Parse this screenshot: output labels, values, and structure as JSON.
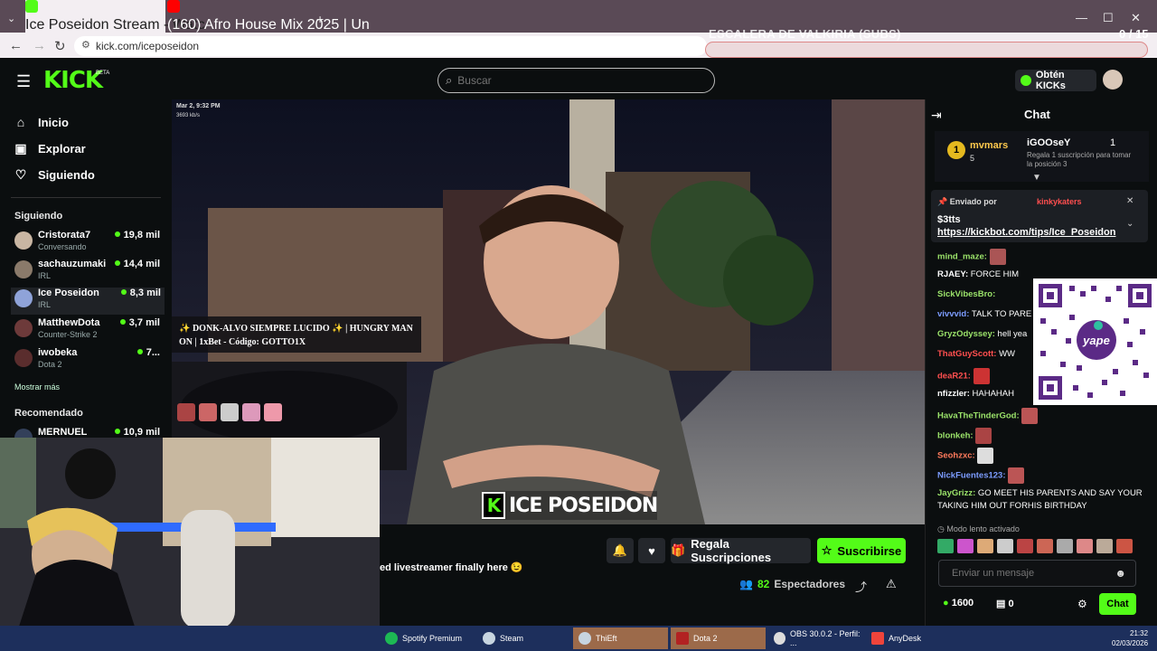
{
  "browser": {
    "tabs": [
      {
        "title": "Ice Poseidon Stream - Watc",
        "active": true
      },
      {
        "title": "(160) Afro House Mix 2025 | Un",
        "active": false
      }
    ],
    "new_tab": "+",
    "url": "kick.com/iceposeidon",
    "overlay_title": "ESCALERA DE VALKIRIA (SUBS)",
    "overlay_count": "0 / 15"
  },
  "header": {
    "logo": "KICK",
    "logo_beta": "BETA",
    "search_placeholder": "Buscar",
    "get_kicks": "Obtén KICKs"
  },
  "sidebar": {
    "nav": [
      {
        "label": "Inicio",
        "icon": "home-icon"
      },
      {
        "label": "Explorar",
        "icon": "compass-icon"
      },
      {
        "label": "Siguiendo",
        "icon": "heart-icon"
      }
    ],
    "following_heading": "Siguiendo",
    "following": [
      {
        "name": "Cristorata7",
        "category": "Conversando",
        "viewers": "19,8 mil"
      },
      {
        "name": "sachauzumaki",
        "category": "IRL",
        "viewers": "14,4 mil"
      },
      {
        "name": "Ice Poseidon",
        "category": "IRL",
        "viewers": "8,3 mil"
      },
      {
        "name": "MatthewDota",
        "category": "Counter-Strike 2",
        "viewers": "3,7 mil"
      },
      {
        "name": "iwobeka",
        "category": "Dota 2",
        "viewers": "7..."
      }
    ],
    "show_more": "Mostrar más",
    "recommended_heading": "Recomendado",
    "recommended": [
      {
        "name": "MERNUEL",
        "viewers": "10,9 mil"
      }
    ]
  },
  "video": {
    "overlay_date": "Mar 2, 9:32 PM",
    "overlay_bitrate": "3693 kb/s",
    "promo_text": "✨ DONK-ALVO SIEMPRE LUCIDO ✨ | HUNGRY MAN ON | 1xBet - Código: GOTTO1X",
    "streamer_tag": "ICE POSEIDON"
  },
  "stream_info": {
    "title": "ed livestreamer finally here 😉",
    "gift_subs": "Regala Suscripciones",
    "subscribe": "Suscribirse",
    "viewers": "82",
    "viewers_label": "Espectadores"
  },
  "chat": {
    "title": "Chat",
    "sub_banner": {
      "top_user": "mvmars",
      "top_user_count": "5",
      "gifter": "iGOOseY",
      "gifter_count": "1",
      "gifter_desc": "Regala 1 suscripción para tomar la posición 3"
    },
    "pinned": {
      "sent_by": "Enviado por",
      "user": "kinkykaters",
      "amount": "$3tts",
      "link": "https://kickbot.com/tips/Ice_Poseidon"
    },
    "messages": [
      {
        "user": "mind_maze:",
        "text": "",
        "color": "#9be36a"
      },
      {
        "user": "RJAEY:",
        "text": "FORCE HIM",
        "color": "#ffffff"
      },
      {
        "user": "SickVibesBro:",
        "text": "",
        "color": "#9be36a"
      },
      {
        "user": "vivvvid:",
        "text": "TALK TO PARE",
        "color": "#7c9cff"
      },
      {
        "user": "GryzOdyssey:",
        "text": "hell yea",
        "color": "#9be36a"
      },
      {
        "user": "ThatGuyScott:",
        "text": "WW",
        "color": "#ff4f4f"
      },
      {
        "user": "deaR21:",
        "text": "",
        "color": "#ff4f4f"
      },
      {
        "user": "nfizzler:",
        "text": "HAHAHAH",
        "color": "#ffffff"
      },
      {
        "user": "HavaTheTinderGod:",
        "text": "",
        "color": "#9be36a"
      },
      {
        "user": "blonkeh:",
        "text": "",
        "color": "#9be36a"
      },
      {
        "user": "Seohzxc:",
        "text": "",
        "color": "#ff7a5c"
      },
      {
        "user": "NickFuentes123:",
        "text": "",
        "color": "#7c9cff"
      },
      {
        "user": "JayGrizz:",
        "text": "GO MEET HIS PARENTS AND SAY YOUR TAKING HIM OUT FORHIS BIRTHDAY",
        "color": "#9be36a"
      }
    ],
    "slow_mode": "Modo lento activado",
    "input_placeholder": "Enviar un mensaje",
    "kicks_balance": "1600",
    "drops": "0",
    "send_label": "Chat",
    "qr_label": "yape"
  },
  "taskbar": {
    "items": [
      {
        "label": "Spotify Premium",
        "color": "#1db954"
      },
      {
        "label": "Steam",
        "color": "#1b2838"
      },
      {
        "label": "ThiEft",
        "color": "#1b2838"
      },
      {
        "label": "Dota 2",
        "color": "#b22222"
      },
      {
        "label": "OBS 30.0.2 - Perfil: ...",
        "color": "#303030"
      },
      {
        "label": "AnyDesk",
        "color": "#ef443b"
      }
    ],
    "time": "21:32",
    "date": "02/03/2026"
  }
}
